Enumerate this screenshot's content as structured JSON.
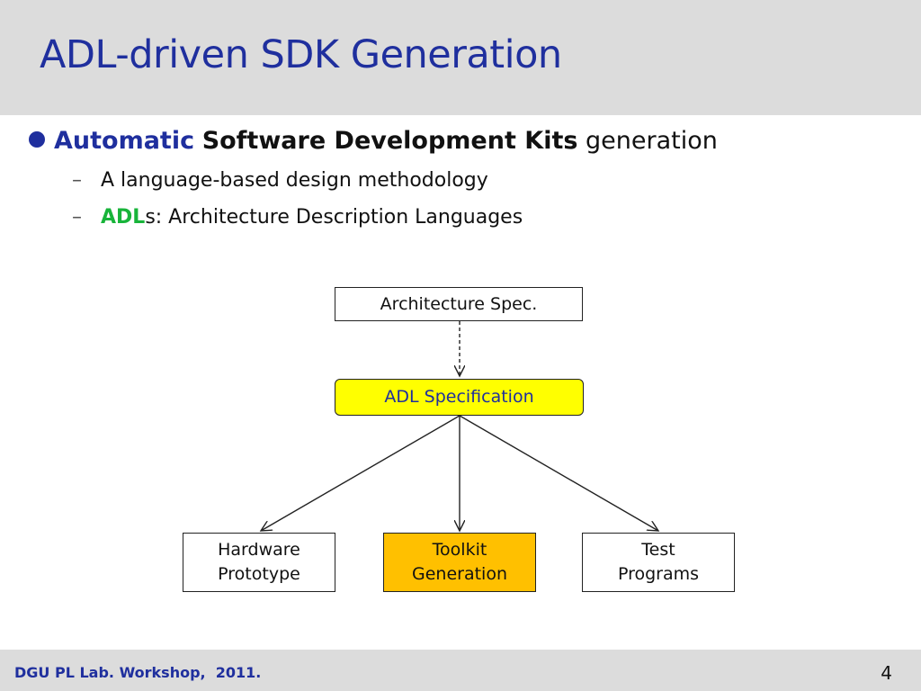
{
  "slide": {
    "title": "ADL-driven SDK Generation",
    "bullet": {
      "part1": "Automatic",
      "part2": "Software Development Kits",
      "part3": "generation"
    },
    "sub_items": [
      {
        "dash": "–",
        "text": "A language-based design methodology"
      },
      {
        "dash": "–",
        "accent": "ADL",
        "text": "s: Architecture Description Languages"
      }
    ],
    "colors": {
      "title": "#1f2f9e",
      "accent_green": "#18b43a",
      "yellow": "#ffff00",
      "orange": "#ffc000"
    }
  },
  "diagram": {
    "arch_spec": "Architecture Spec.",
    "adl_spec": "ADL Specification",
    "hardware": [
      "Hardware",
      "Prototype"
    ],
    "toolkit": [
      "Toolkit",
      "Generation"
    ],
    "test": [
      "Test",
      "Programs"
    ]
  },
  "footer": {
    "text": "DGU PL Lab. Workshop,  2011.",
    "page": "4"
  }
}
